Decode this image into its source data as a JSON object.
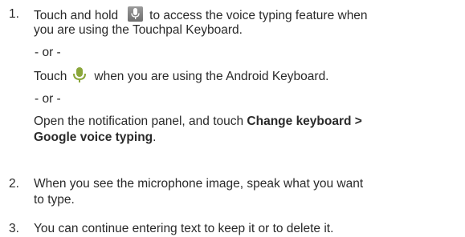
{
  "steps": [
    {
      "number": "1.",
      "line1_pre": "Touch and hold",
      "line1_post": "to access the voice typing feature when",
      "line2": "you are using the Touchpal Keyboard.",
      "or1": "- or -",
      "line3_pre": "Touch",
      "line3_post": "when you are using the Android Keyboard.",
      "or2": "- or -",
      "line4": "Open the notification panel, and touch ",
      "line4_bold": "Change keyboard >",
      "line5_bold": "Google voice typing",
      "line5_post": "."
    },
    {
      "number": "2.",
      "line1": "When you see the microphone image, speak what you want",
      "line2": "to type."
    },
    {
      "number": "3.",
      "line1": "You can continue entering text to keep it or to delete it."
    }
  ],
  "icons": {
    "touchpal_mic": "microphone-icon-boxed",
    "android_mic": "microphone-icon"
  },
  "colors": {
    "text": "#2a2a2a",
    "icon_box": "#7f7f7f",
    "android_mic": "#8aa63a"
  }
}
